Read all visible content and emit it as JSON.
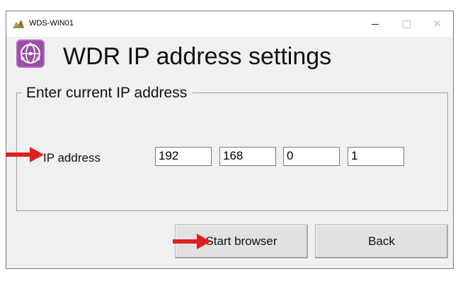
{
  "window": {
    "title": "WDS-WIN01",
    "controls": {
      "minimize_icon": "minimize-icon",
      "maximize_icon": "maximize-icon",
      "close_icon": "close-icon",
      "close_glyph": "✕"
    }
  },
  "header": {
    "title": "WDR IP address settings",
    "icon": "network-globe-icon"
  },
  "group": {
    "label": "Enter current IP address",
    "ip_label": "IP address",
    "octets": [
      "192",
      "168",
      "0",
      "1"
    ]
  },
  "buttons": {
    "start_label": "Start browser",
    "back_label": "Back"
  },
  "annotations": {
    "arrow_color": "#e02020",
    "arrows": [
      "pointer-arrow-icon",
      "pointer-arrow-icon"
    ]
  },
  "colors": {
    "window_bg": "#f0f0f0",
    "header_icon_bg": "#9b4fa6"
  }
}
